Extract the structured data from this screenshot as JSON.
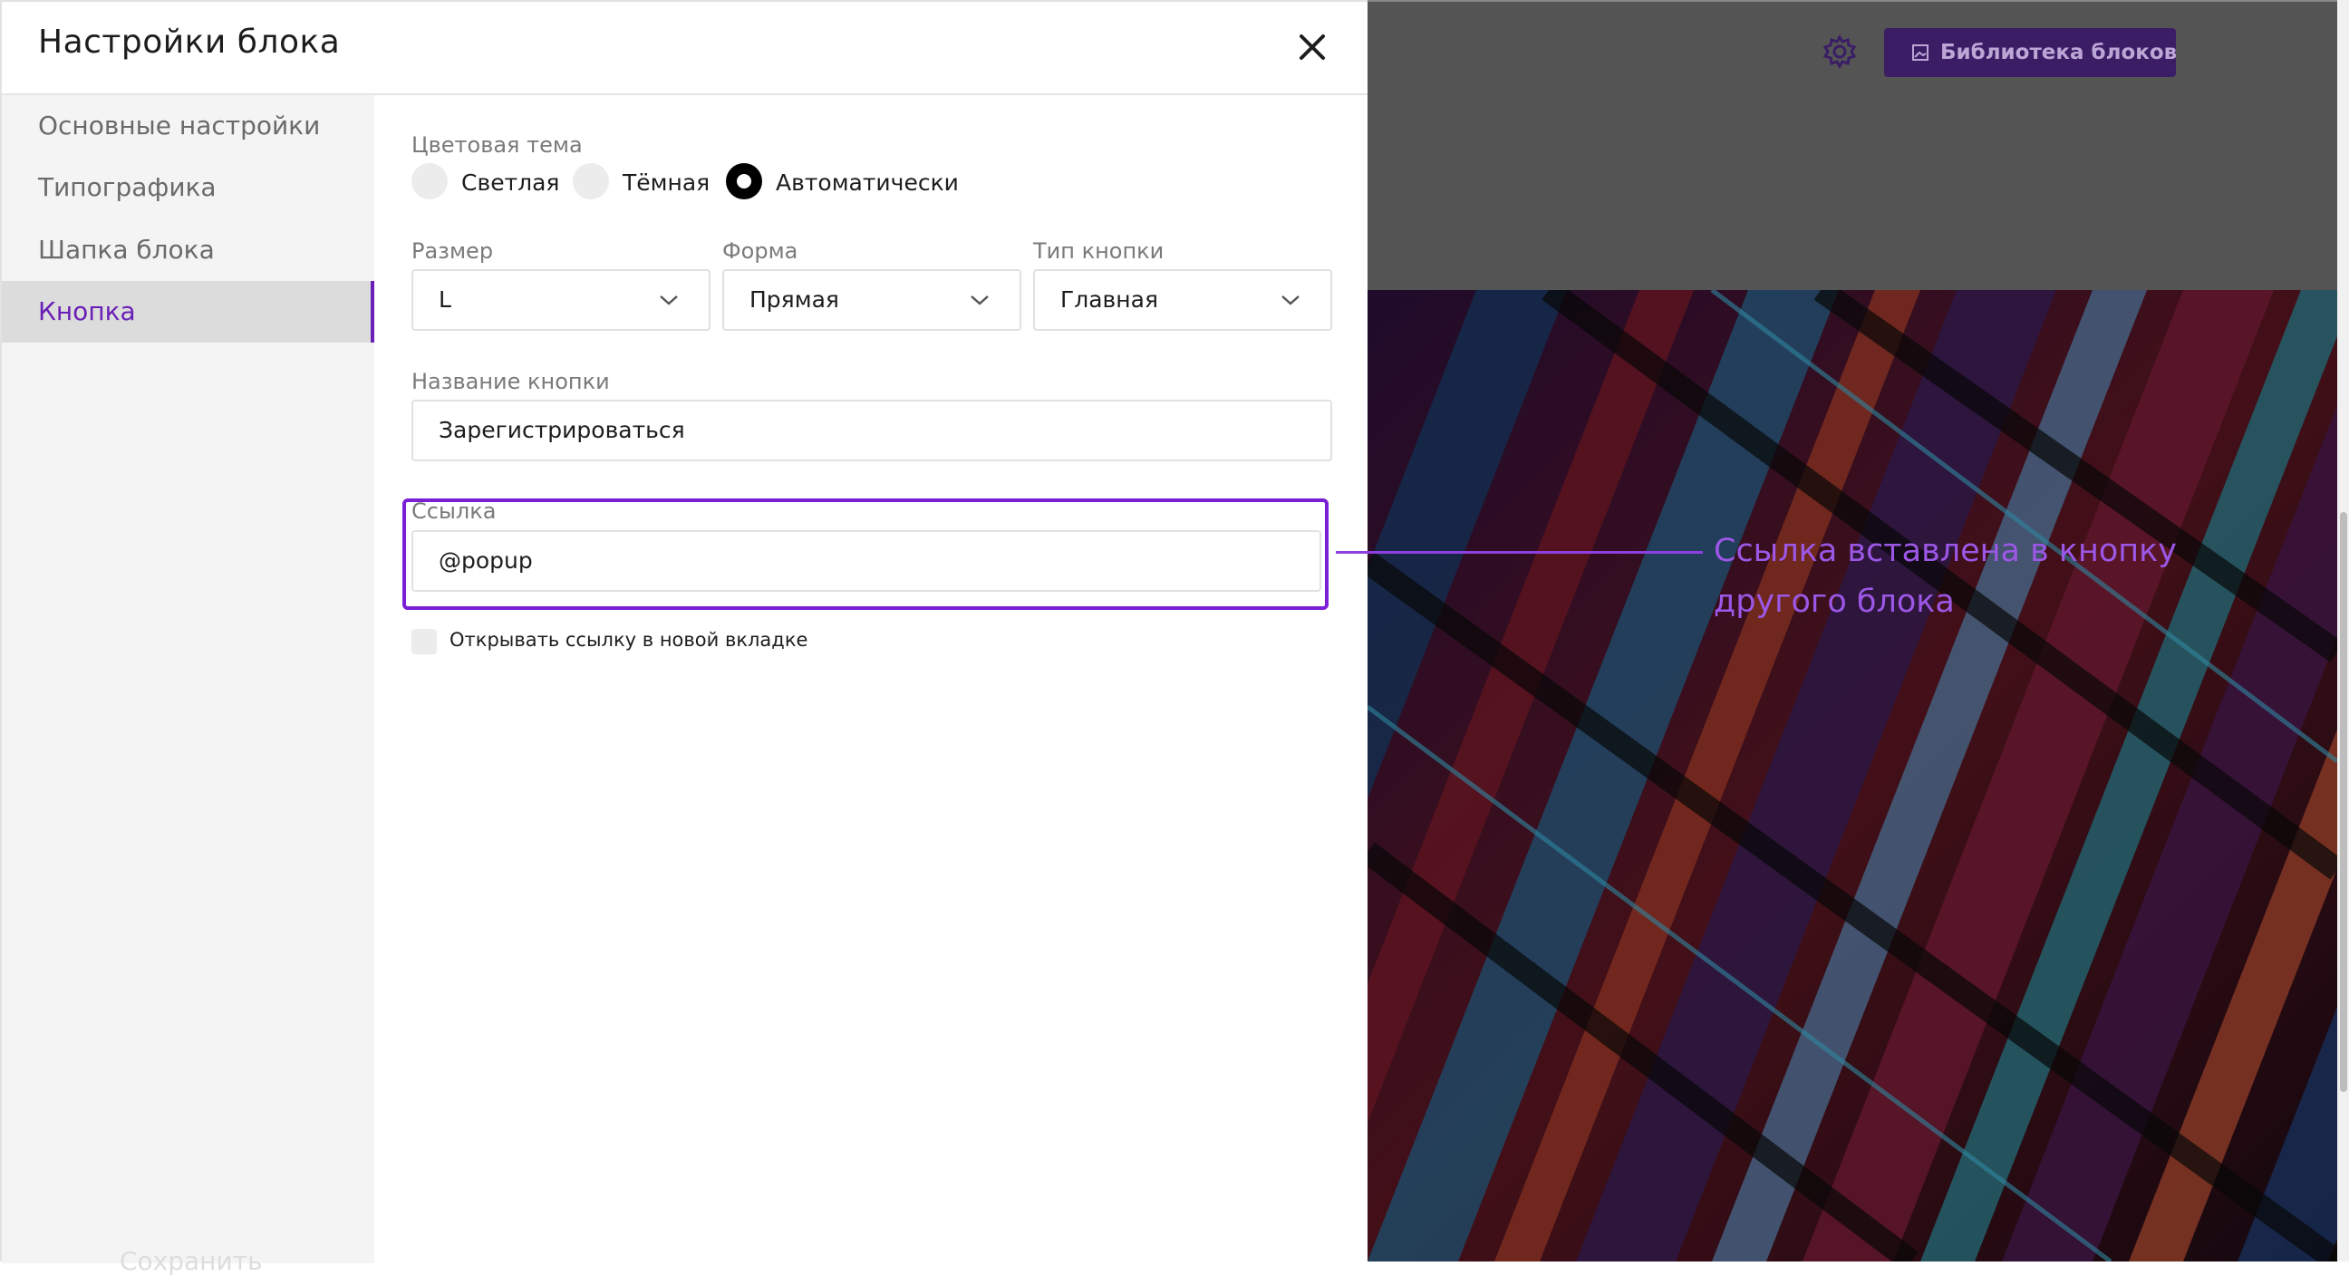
{
  "modal": {
    "title": "Настройки блока",
    "close_icon": "close-icon"
  },
  "sidebar": {
    "items": [
      {
        "label": "Основные настройки",
        "active": false
      },
      {
        "label": "Типографика",
        "active": false
      },
      {
        "label": "Шапка блока",
        "active": false
      },
      {
        "label": "Кнопка",
        "active": true
      }
    ],
    "save_label": "Сохранить"
  },
  "form": {
    "color_theme": {
      "label": "Цветовая тема",
      "options": [
        "Светлая",
        "Тёмная",
        "Автоматически"
      ],
      "selected": "Автоматически"
    },
    "size": {
      "label": "Размер",
      "value": "L"
    },
    "shape": {
      "label": "Форма",
      "value": "Прямая"
    },
    "button_type": {
      "label": "Тип кнопки",
      "value": "Главная"
    },
    "button_name": {
      "label": "Название кнопки",
      "value": "Зарегистрироваться"
    },
    "link": {
      "label": "Ссылка",
      "value": "@popup"
    },
    "new_tab": {
      "label": "Открывать ссылку в новой вкладке",
      "checked": false
    }
  },
  "preview": {
    "library_button": "Библиотека блоков",
    "gear_icon": "gear-icon"
  },
  "annotation": {
    "text": "Ссылка вставлена в кнопку другого блока"
  },
  "colors": {
    "accent": "#6a1fb6",
    "highlight": "#7a1fd6",
    "annotation": "#9c57e6",
    "library_button_bg": "#3b1d66"
  }
}
